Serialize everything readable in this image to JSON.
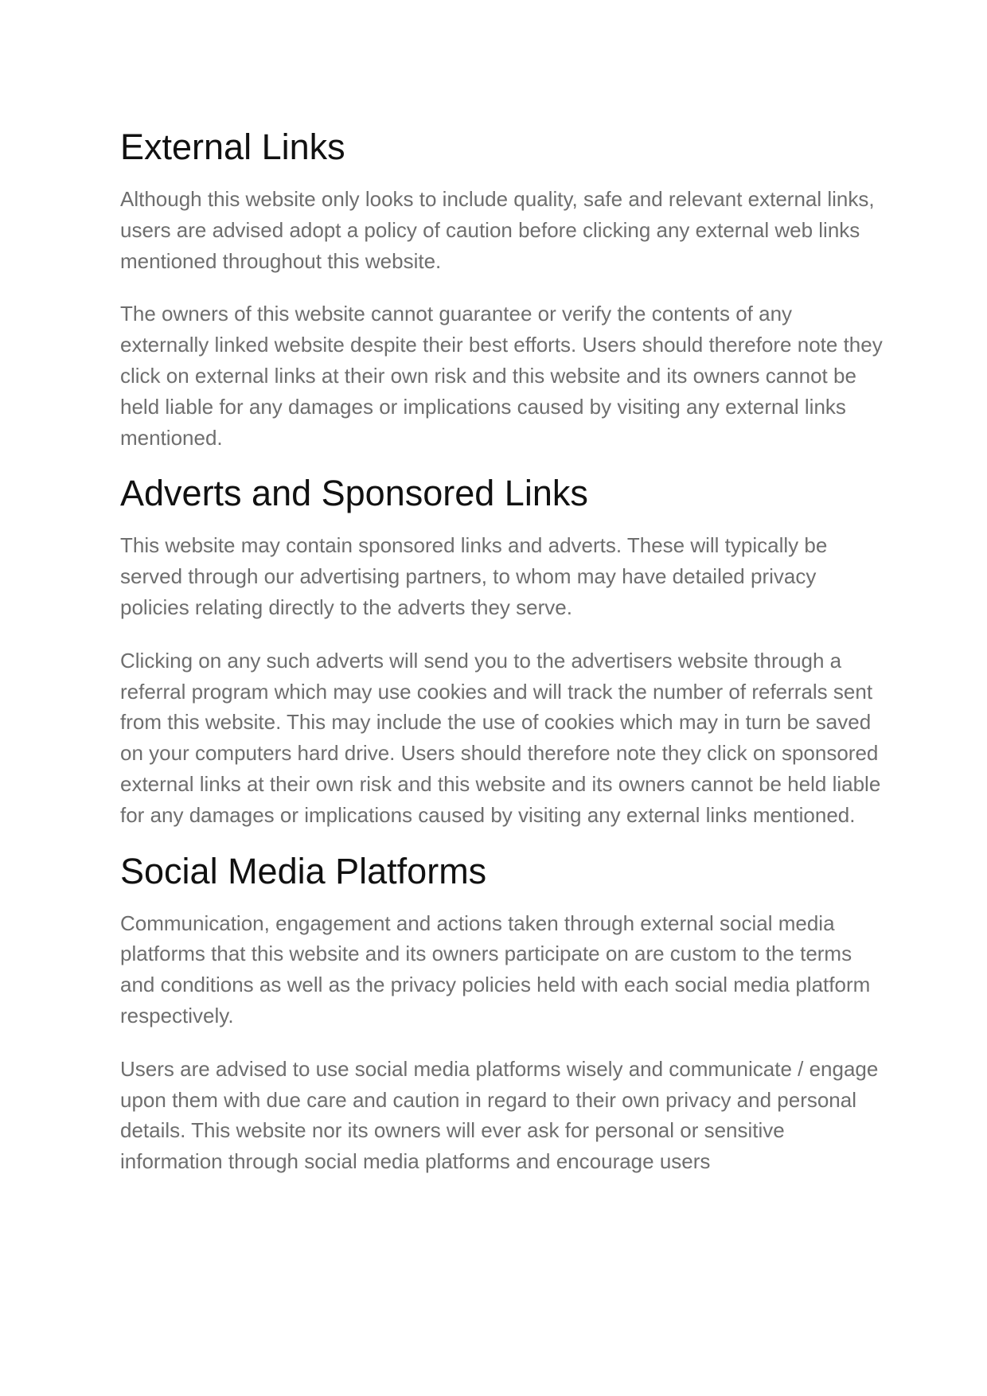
{
  "sections": [
    {
      "heading": "External Links",
      "paragraphs": [
        "Although this website only looks to include quality, safe and relevant external links, users are advised adopt a policy of caution before clicking any external web links mentioned throughout this website.",
        "The owners of this website cannot guarantee or verify the contents of any externally linked website despite their best efforts. Users should therefore note they click on external links at their own risk and this website and its owners cannot be held liable for any damages or implications caused by visiting any external links mentioned."
      ]
    },
    {
      "heading": "Adverts and Sponsored Links",
      "paragraphs": [
        "This website may contain sponsored links and adverts. These will typically be served through our advertising partners, to whom may have detailed privacy policies relating directly to the adverts they serve.",
        "Clicking on any such adverts will send you to the advertisers website through a referral program which may use cookies and will track the number of referrals sent from this website. This may include the use of cookies which may in turn be saved on your computers hard drive. Users should therefore note they click on sponsored external links at their own risk and this website and its owners cannot be held liable for any damages or implications caused by visiting any external links mentioned."
      ]
    },
    {
      "heading": "Social Media Platforms",
      "paragraphs": [
        "Communication, engagement and actions taken through external social media platforms that this website and its owners participate on are custom to the terms and conditions as well as the privacy policies held with each social media platform respectively.",
        "Users are advised to use social media platforms wisely and communicate / engage upon them with due care and caution in regard to their own privacy and personal details. This website nor its owners will ever ask for personal or sensitive information through social media platforms and encourage users"
      ]
    }
  ]
}
